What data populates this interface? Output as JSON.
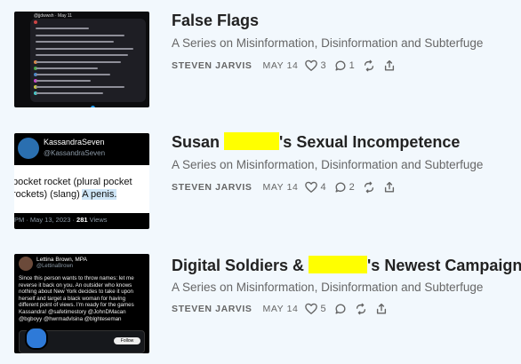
{
  "posts": [
    {
      "title": "False Flags",
      "subtitle": "A Series on Misinformation, Disinformation and Subterfuge",
      "author": "STEVEN JARVIS",
      "date": "MAY 14",
      "likes": "3",
      "comments": "1",
      "thumb": {
        "handle": "@jjdwwsh · May 11",
        "line_count": 12
      }
    },
    {
      "title_before": "Susan ",
      "title_after": "'s Sexual Incompetence",
      "subtitle": "A Series on Misinformation, Disinformation and Subterfuge",
      "author": "STEVEN JARVIS",
      "date": "MAY 14",
      "likes": "4",
      "comments": "2",
      "thumb": {
        "name": "KassandraSeven",
        "handle": "@KassandraSeven",
        "text_plain": "pocket rocket (plural pocket rockets) (slang) ",
        "text_highlight": "A penis.",
        "timestamp": "PM · May 13, 2023 · ",
        "views": "281",
        "views_label": " Views"
      }
    },
    {
      "title_before": "Digital Soldiers & ",
      "title_after": "'s Newest Campaign",
      "subtitle": "A Series on Misinformation, Disinformation and Subterfuge",
      "author": "STEVEN JARVIS",
      "date": "MAY 14",
      "likes": "5",
      "thumb": {
        "name": "Lettina Brown, MPA",
        "handle": "@LettinaBrown",
        "text": "Since this person wants to throw names: let me reverse it back on you. An outsider who knows nothing about New York decides to take it upon herself and target a black woman for having different point of views. I'm ready for the games Kassandra! @safetimestory @JohnDMacan @bgboyy @hwrmadvlsina @blghteseman",
        "follow": "Follow"
      }
    }
  ],
  "icons": {
    "like": "heart-icon",
    "comment": "comment-icon",
    "restack": "restack-icon",
    "share": "share-icon"
  },
  "colors": {
    "background": "#f2f8fd",
    "redaction": "#ffff00",
    "meta": "#666666"
  }
}
